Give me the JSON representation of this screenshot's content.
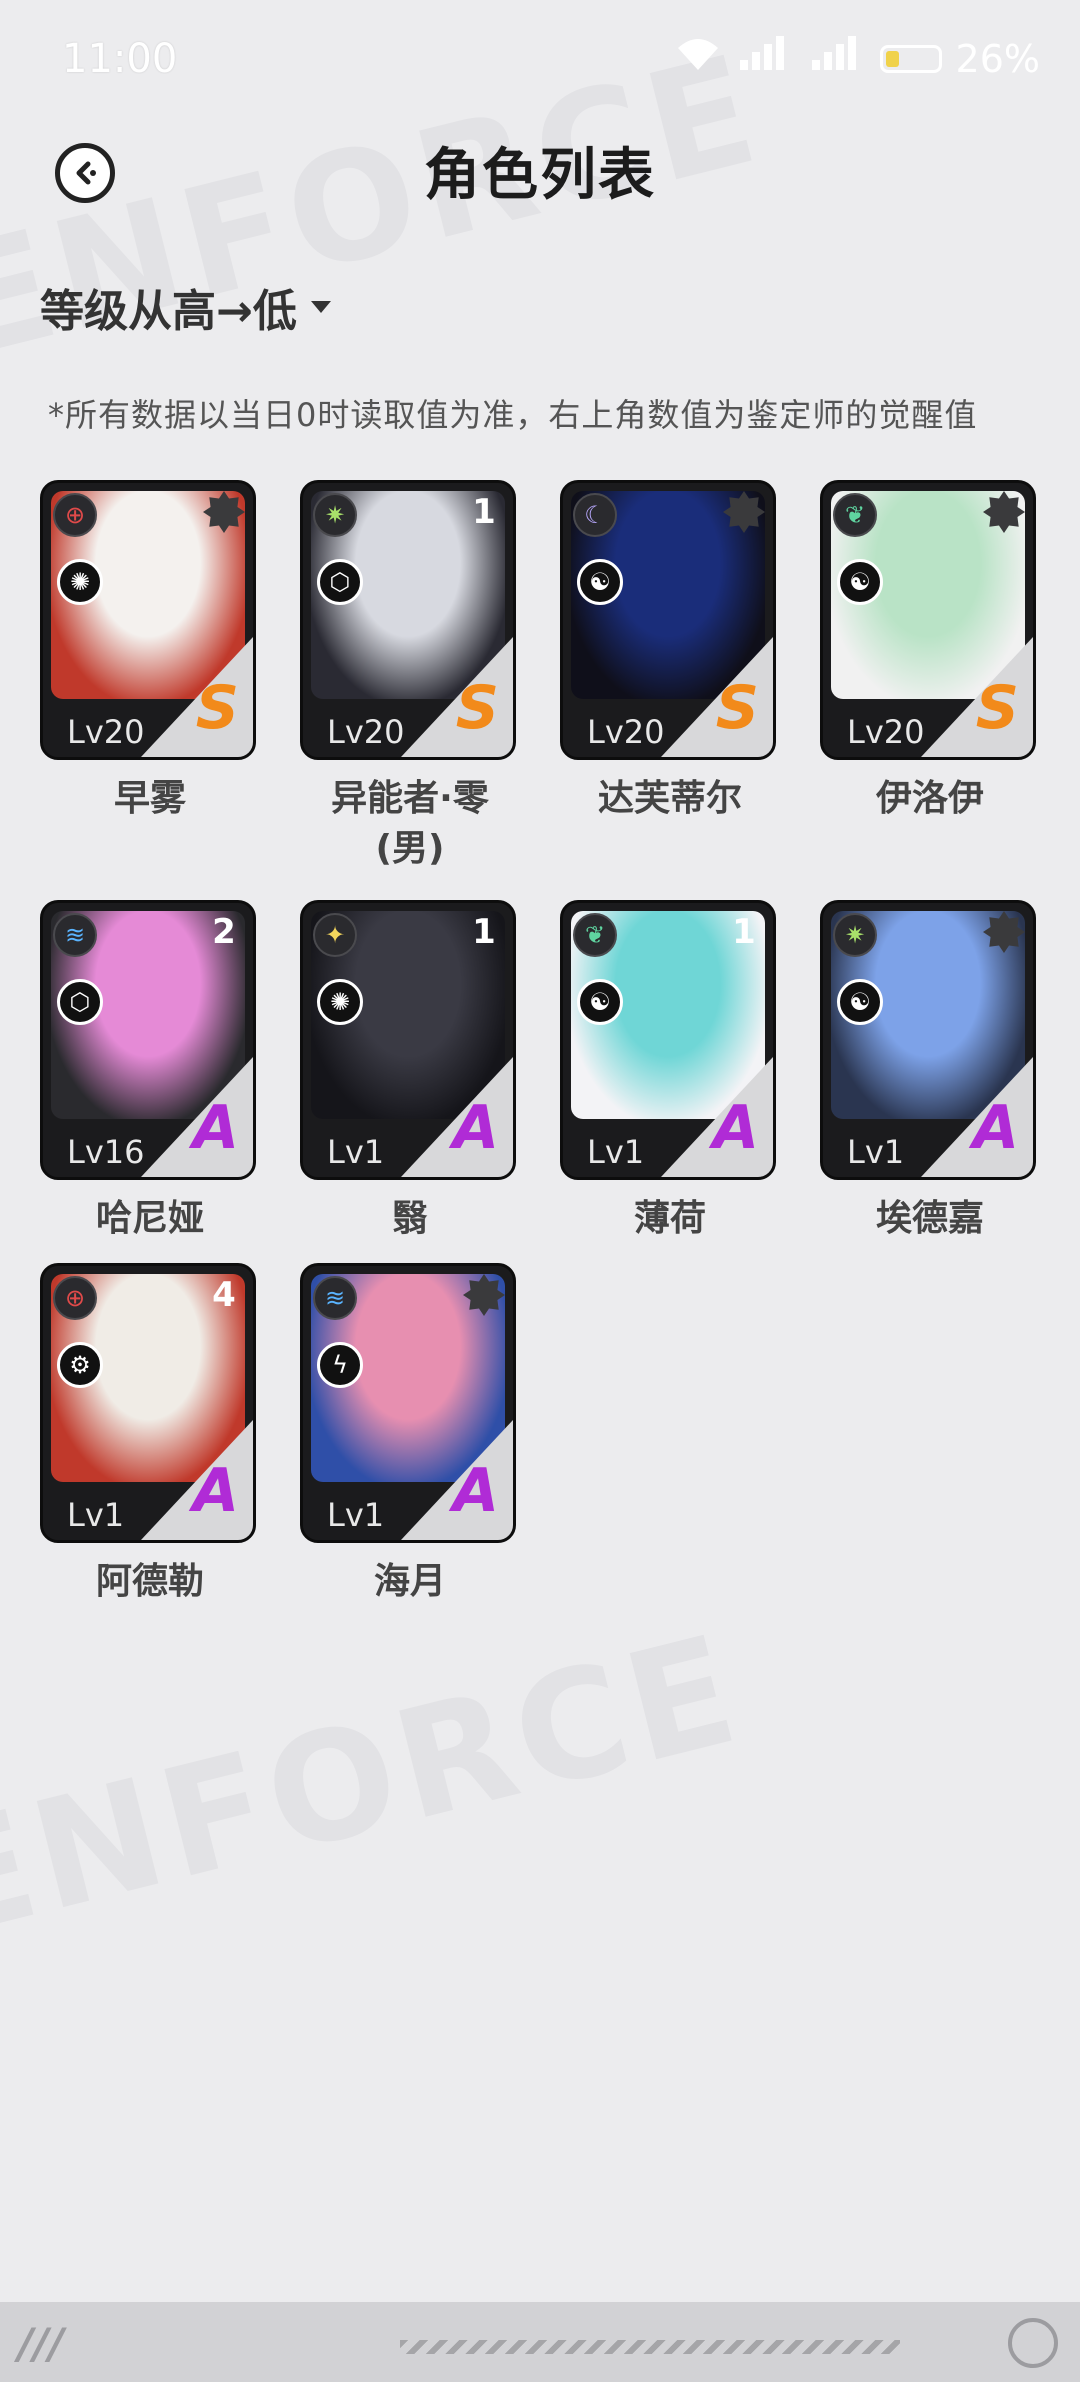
{
  "status_bar": {
    "time": "11:00",
    "battery_percent": "26%",
    "battery_level": 0.26,
    "network": "5G"
  },
  "header": {
    "title": "角色列表",
    "back_icon": "back-arrow-icon"
  },
  "sort": {
    "label": "等级从高→低"
  },
  "note": "*所有数据以当日0时读取值为准，右上角数值为鉴定师的觉醒值",
  "characters": [
    {
      "name": "早雾",
      "level": "Lv20",
      "rank": "S",
      "awakening": "",
      "attribute_color": "#e04a4a",
      "attribute_icon": "crosshair-icon",
      "class_icon": "vortex-icon",
      "theme": [
        "#f4f1ee",
        "#c0392b"
      ]
    },
    {
      "name": "异能者·零(男)",
      "level": "Lv20",
      "rank": "S",
      "awakening": "1",
      "attribute_color": "#a8e06a",
      "attribute_icon": "sun-icon",
      "class_icon": "cube-icon",
      "theme": [
        "#d7d9e0",
        "#2a2a33"
      ]
    },
    {
      "name": "达芙蒂尔",
      "level": "Lv20",
      "rank": "S",
      "awakening": "",
      "attribute_color": "#b9a9ff",
      "attribute_icon": "moon-icon",
      "class_icon": "swirl-icon",
      "theme": [
        "#1a2d7a",
        "#0f0f1a"
      ]
    },
    {
      "name": "伊洛伊",
      "level": "Lv20",
      "rank": "S",
      "awakening": "",
      "attribute_color": "#5fd4a0",
      "attribute_icon": "leaf-icon",
      "class_icon": "swirl-icon",
      "theme": [
        "#b9e3c6",
        "#f1f1f1"
      ]
    },
    {
      "name": "哈尼娅",
      "level": "Lv16",
      "rank": "A",
      "awakening": "2",
      "attribute_color": "#5ab4ff",
      "attribute_icon": "wave-icon",
      "class_icon": "cube-icon",
      "theme": [
        "#e58ad6",
        "#2a2a2e"
      ]
    },
    {
      "name": "翳",
      "level": "Lv1",
      "rank": "A",
      "awakening": "1",
      "attribute_color": "#f2d55c",
      "attribute_icon": "sparkle-icon",
      "class_icon": "vortex-icon",
      "theme": [
        "#3a3a44",
        "#15151a"
      ]
    },
    {
      "name": "薄荷",
      "level": "Lv1",
      "rank": "A",
      "awakening": "1",
      "attribute_color": "#5fd4a0",
      "attribute_icon": "leaf-icon",
      "class_icon": "swirl-icon",
      "theme": [
        "#6fd6d6",
        "#f3f3f6"
      ]
    },
    {
      "name": "埃德嘉",
      "level": "Lv1",
      "rank": "A",
      "awakening": "",
      "attribute_color": "#a8e06a",
      "attribute_icon": "sun-icon",
      "class_icon": "swirl-icon",
      "theme": [
        "#7da2e8",
        "#2a3550"
      ]
    },
    {
      "name": "阿德勒",
      "level": "Lv1",
      "rank": "A",
      "awakening": "4",
      "attribute_color": "#e04a4a",
      "attribute_icon": "crosshair-icon",
      "class_icon": "gear-icon",
      "theme": [
        "#f0ece6",
        "#c0392b"
      ]
    },
    {
      "name": "海月",
      "level": "Lv1",
      "rank": "A",
      "awakening": "",
      "attribute_color": "#5ab4ff",
      "attribute_icon": "wave-icon",
      "class_icon": "bolt-icon",
      "theme": [
        "#e78fb0",
        "#2f4fa8"
      ]
    }
  ]
}
